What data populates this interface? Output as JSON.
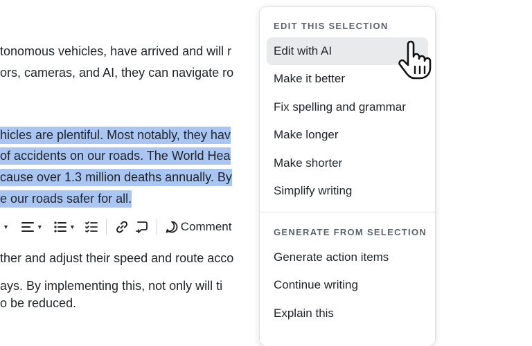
{
  "document": {
    "lines": [
      "tonomous vehicles, have arrived and will r",
      "ors, cameras, and AI, they can navigate ro",
      "hicles are plentiful. Most notably, they hav",
      "of accidents on our roads. The World Hea",
      "cause over 1.3 million deaths annually. By",
      "e our roads safer for all.",
      "ther and adjust their speed and route acco",
      "ays. By implementing this, not only will ti",
      "o be reduced."
    ]
  },
  "toolbar": {
    "comment_label": "Comment"
  },
  "menu": {
    "section1_heading": "EDIT THIS SELECTION",
    "section1_items": [
      "Edit with AI",
      "Make it better",
      "Fix spelling and grammar",
      "Make longer",
      "Make shorter",
      "Simplify writing"
    ],
    "section2_heading": "GENERATE FROM SELECTION",
    "section2_items": [
      "Generate action items",
      "Continue writing",
      "Explain this"
    ],
    "hovered_item": "Edit with AI"
  },
  "icons": {
    "cursor": "pointing-hand-cursor-icon",
    "toolbar": [
      "chevron-down-icon",
      "align-icon",
      "bullet-list-icon",
      "checklist-icon",
      "link-icon",
      "comment-icon"
    ]
  },
  "colors": {
    "selection": "#a9c6f3",
    "menu_hover": "#e9eaec",
    "heading": "#5b616b"
  }
}
